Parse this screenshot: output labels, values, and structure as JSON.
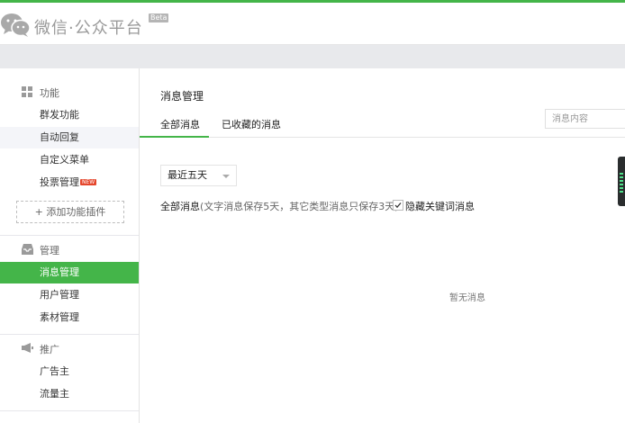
{
  "header": {
    "brand": "微信·公众平台",
    "beta": "Beta"
  },
  "sidebar": {
    "sections": [
      {
        "title": "功能",
        "icon": "grid-icon",
        "items": [
          {
            "label": "群发功能"
          },
          {
            "label": "自动回复"
          },
          {
            "label": "自定义菜单"
          },
          {
            "label": "投票管理",
            "badge": "NEW"
          }
        ],
        "add_plugin": "+ 添加功能插件"
      },
      {
        "title": "管理",
        "icon": "inbox-icon",
        "items": [
          {
            "label": "消息管理"
          },
          {
            "label": "用户管理"
          },
          {
            "label": "素材管理"
          }
        ]
      },
      {
        "title": "推广",
        "icon": "megaphone-icon",
        "items": [
          {
            "label": "广告主"
          },
          {
            "label": "流量主"
          }
        ]
      }
    ]
  },
  "main": {
    "title": "消息管理",
    "tabs": [
      {
        "label": "全部消息"
      },
      {
        "label": "已收藏的消息"
      }
    ],
    "search_placeholder": "消息内容",
    "filter": {
      "selected": "最近五天"
    },
    "info_prefix": "全部消息",
    "info_note": "(文字消息保存5天，其它类型消息只保存3天)",
    "hide_keyword_label": "隐藏关键词消息",
    "hide_keyword_checked": true,
    "empty_text": "暂无消息"
  },
  "colors": {
    "accent": "#44b549",
    "badge": "#e5462c"
  }
}
